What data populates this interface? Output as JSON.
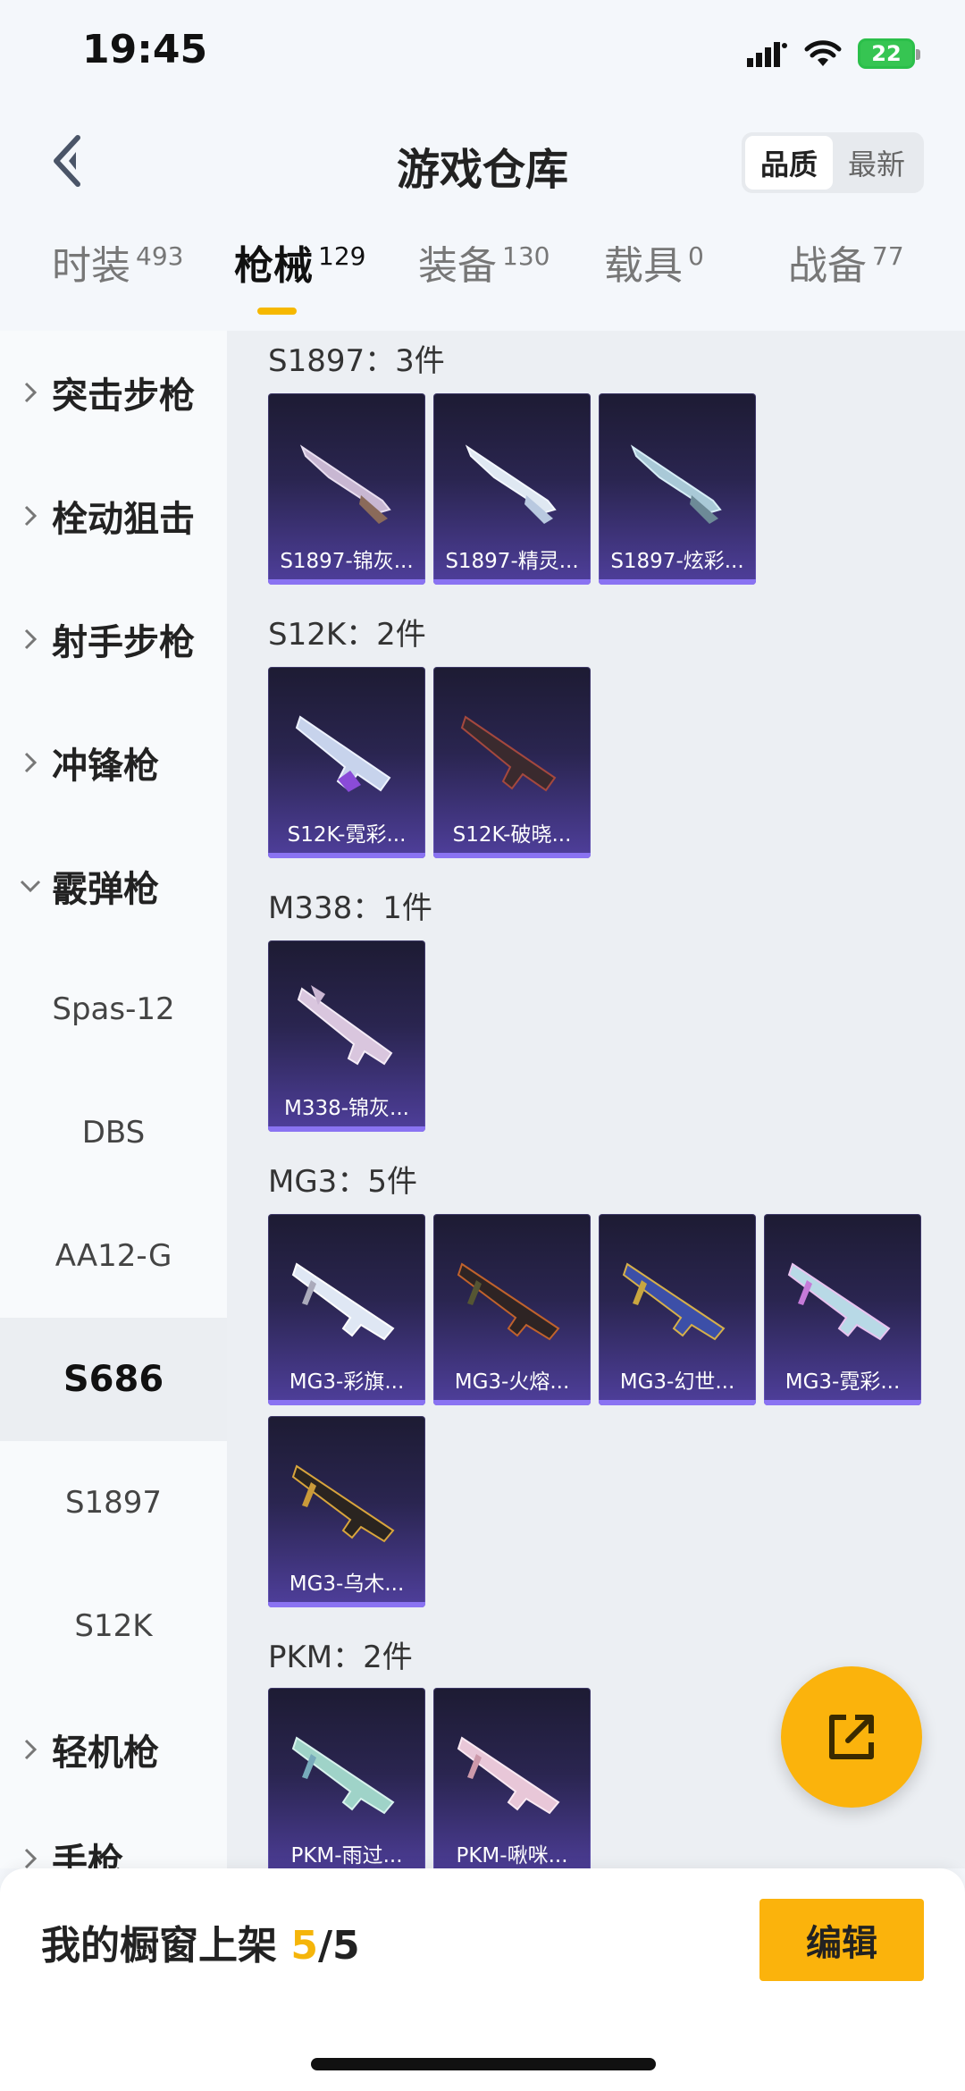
{
  "status": {
    "time": "19:45",
    "battery": "22"
  },
  "header": {
    "title": "游戏仓库",
    "sort": [
      "品质",
      "最新"
    ]
  },
  "tabs": [
    {
      "label": "时装",
      "count": "493"
    },
    {
      "label": "枪械",
      "count": "129"
    },
    {
      "label": "装备",
      "count": "130"
    },
    {
      "label": "载具",
      "count": "0"
    },
    {
      "label": "战备",
      "count": "77"
    }
  ],
  "sidebar": {
    "categories": [
      "突击步枪",
      "栓动狙击",
      "射手步枪",
      "冲锋枪",
      "霰弹枪",
      "轻机枪",
      "手枪"
    ],
    "subitems": [
      "Spas-12",
      "DBS",
      "AA12-G",
      "S686",
      "S1897",
      "S12K"
    ]
  },
  "groups": [
    {
      "title": "S1897：3件",
      "items": [
        "S1897-锦灰...",
        "S1897-精灵...",
        "S1897-炫彩..."
      ]
    },
    {
      "title": "S12K：2件",
      "items": [
        "S12K-霓彩...",
        "S12K-破晓..."
      ]
    },
    {
      "title": "M338：1件",
      "items": [
        "M338-锦灰..."
      ]
    },
    {
      "title": "MG3：5件",
      "items": [
        "MG3-彩旗...",
        "MG3-火熔...",
        "MG3-幻世...",
        "MG3-霓彩...",
        "MG3-乌木..."
      ]
    },
    {
      "title": "PKM：2件",
      "items": [
        "PKM-雨过...",
        "PKM-啾咪..."
      ]
    }
  ],
  "bottom": {
    "shelf_label": "我的橱窗上架 ",
    "shelf_current": "5",
    "shelf_total": "/5",
    "edit_label": "编辑"
  },
  "colors": {
    "accent": "#fbb30c",
    "card_bottom": "#4f3f9c",
    "card_top": "#1d1b33"
  }
}
